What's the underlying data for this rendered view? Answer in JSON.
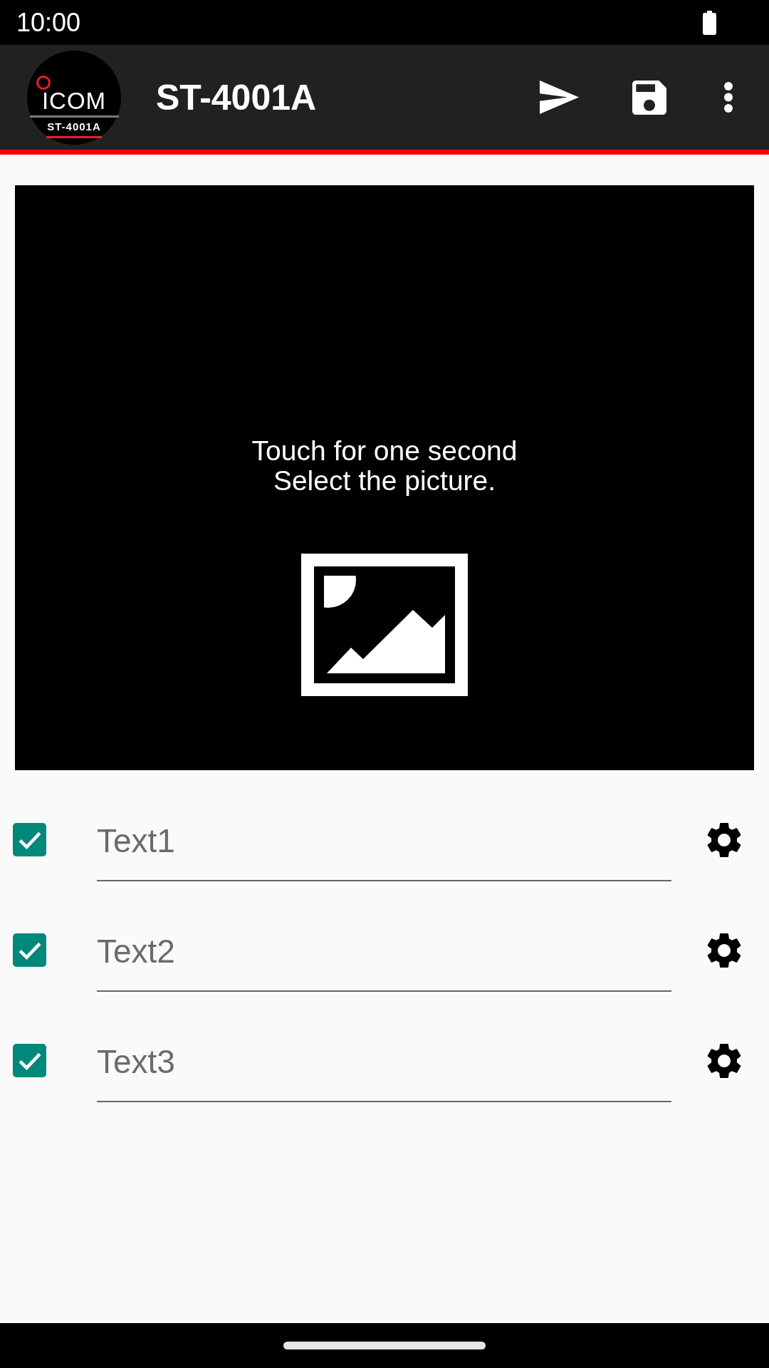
{
  "status_bar": {
    "time": "10:00"
  },
  "app_bar": {
    "logo": {
      "brand": "ICOM",
      "model": "ST-4001A"
    },
    "title": "ST-4001A"
  },
  "picture_area": {
    "instruction": "Touch for one second\nSelect the picture."
  },
  "text_rows": [
    {
      "checked": true,
      "value": "Text1"
    },
    {
      "checked": true,
      "value": "Text2"
    },
    {
      "checked": true,
      "value": "Text3"
    }
  ]
}
